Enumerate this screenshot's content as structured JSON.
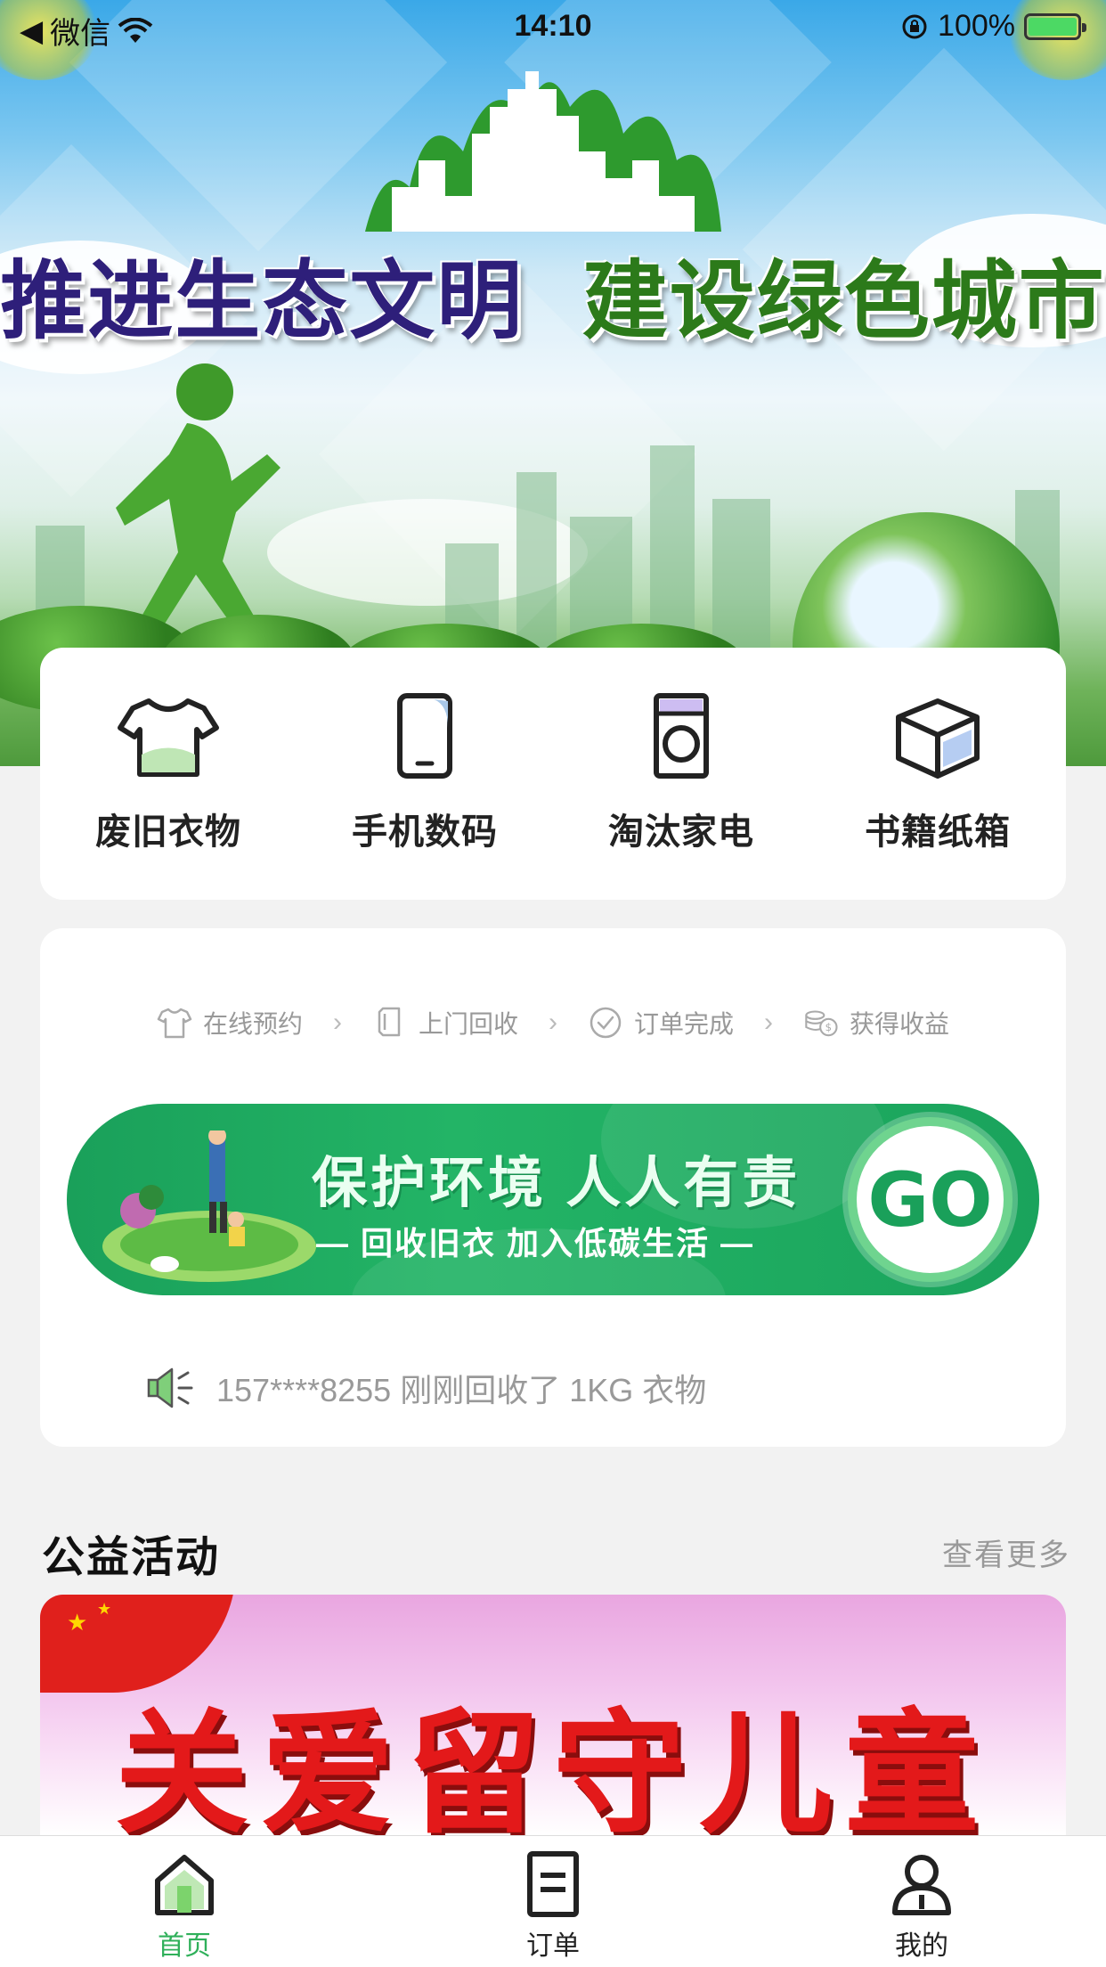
{
  "status_bar": {
    "back_app": "微信",
    "time": "14:10",
    "battery": "100%"
  },
  "hero": {
    "title_left": "推进生态文明",
    "title_right": "建设绿色城市"
  },
  "categories": [
    {
      "label": "废旧衣物",
      "icon": "tshirt-icon"
    },
    {
      "label": "手机数码",
      "icon": "phone-icon"
    },
    {
      "label": "淘汰家电",
      "icon": "washing-machine-icon"
    },
    {
      "label": "书籍纸箱",
      "icon": "box-icon"
    }
  ],
  "steps": [
    {
      "label": "在线预约",
      "icon": "tshirt-outline-icon"
    },
    {
      "label": "上门回收",
      "icon": "clothes-tag-icon"
    },
    {
      "label": "订单完成",
      "icon": "check-circle-icon"
    },
    {
      "label": "获得收益",
      "icon": "coins-icon"
    }
  ],
  "go_banner": {
    "main": "保护环境 人人有责",
    "sub": "— 回收旧衣 加入低碳生活 —",
    "button": "GO"
  },
  "notice": {
    "text": "157****8255 刚刚回收了 1KG 衣物"
  },
  "section": {
    "title": "公益活动",
    "more": "查看更多"
  },
  "activity": {
    "title": "关爱留守儿童"
  },
  "tabbar": {
    "home": "首页",
    "orders": "订单",
    "mine": "我的"
  },
  "colors": {
    "accent_green": "#2fb05a",
    "banner_green": "#1aa05a",
    "muted_text": "#999999"
  }
}
